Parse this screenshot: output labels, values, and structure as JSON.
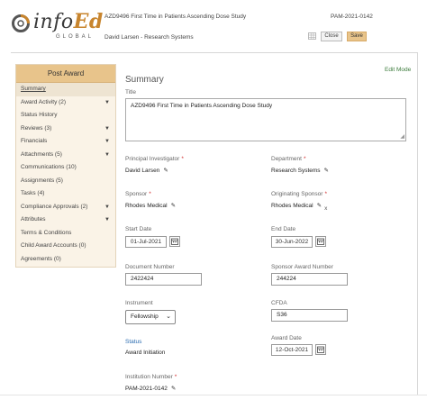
{
  "header": {
    "logo_text": "infoEd",
    "logo_subtext": "GLOBAL",
    "title": "AZD9496 First Time in Patients Ascending Dose Study",
    "record_id": "PAM-2021-0142",
    "user": "David Larsen - Research Systems",
    "close_label": "Close",
    "save_label": "Save"
  },
  "sidebar": {
    "heading": "Post Award",
    "items": [
      {
        "label": "Summary",
        "arrow": ""
      },
      {
        "label": "Award Activity (2)",
        "arrow": "▼"
      },
      {
        "label": "Status History",
        "arrow": ""
      },
      {
        "label": "Reviews (3)",
        "arrow": "▼"
      },
      {
        "label": "Financials",
        "arrow": "▼"
      },
      {
        "label": "Attachments (5)",
        "arrow": "▼"
      },
      {
        "label": "Communications (10)",
        "arrow": ""
      },
      {
        "label": "Assignments (5)",
        "arrow": ""
      },
      {
        "label": "Tasks (4)",
        "arrow": ""
      },
      {
        "label": "Compliance Approvals (2)",
        "arrow": "▼"
      },
      {
        "label": "Attributes",
        "arrow": "▼"
      },
      {
        "label": "Terms & Conditions",
        "arrow": ""
      },
      {
        "label": "Child Award Accounts (0)",
        "arrow": ""
      },
      {
        "label": "Agreements (0)",
        "arrow": ""
      }
    ]
  },
  "main": {
    "edit_mode": "Edit Mode",
    "section_title": "Summary",
    "title_label": "Title",
    "title_value": "AZD9496 First Time in Patients Ascending Dose Study",
    "pi_label": "Principal Investigator",
    "pi_value": "David Larsen",
    "department_label": "Department",
    "department_value": "Research Systems",
    "sponsor_label": "Sponsor",
    "sponsor_value": "Rhodes Medical",
    "orig_sponsor_label": "Originating Sponsor",
    "orig_sponsor_value": "Rhodes Medical",
    "start_date_label": "Start Date",
    "start_date_value": "01-Jul-2021",
    "end_date_label": "End Date",
    "end_date_value": "30-Jun-2022",
    "doc_number_label": "Document Number",
    "doc_number_value": "2422424",
    "sponsor_award_label": "Sponsor Award Number",
    "sponsor_award_value": "244224",
    "instrument_label": "Instrument",
    "instrument_value": "Fellowship",
    "cfda_label": "CFDA",
    "cfda_value": "S36",
    "status_label": "Status",
    "status_value": "Award Initiation",
    "award_date_label": "Award Date",
    "award_date_value": "12-Oct-2021",
    "institution_label": "Institution Number",
    "institution_value": "PAM-2021-0142",
    "required_mark": "*"
  },
  "icons": {
    "pencil": "pencil-icon",
    "calendar": "calendar-icon",
    "grid": "grid-icon",
    "logo": "infoed-swirl-logo"
  },
  "colors": {
    "accent": "#e8c48b",
    "sidebar_bg": "#faf3e7",
    "required": "#d12a2a",
    "edit_mode": "#3a7a3a",
    "link": "#2b6cb0"
  }
}
